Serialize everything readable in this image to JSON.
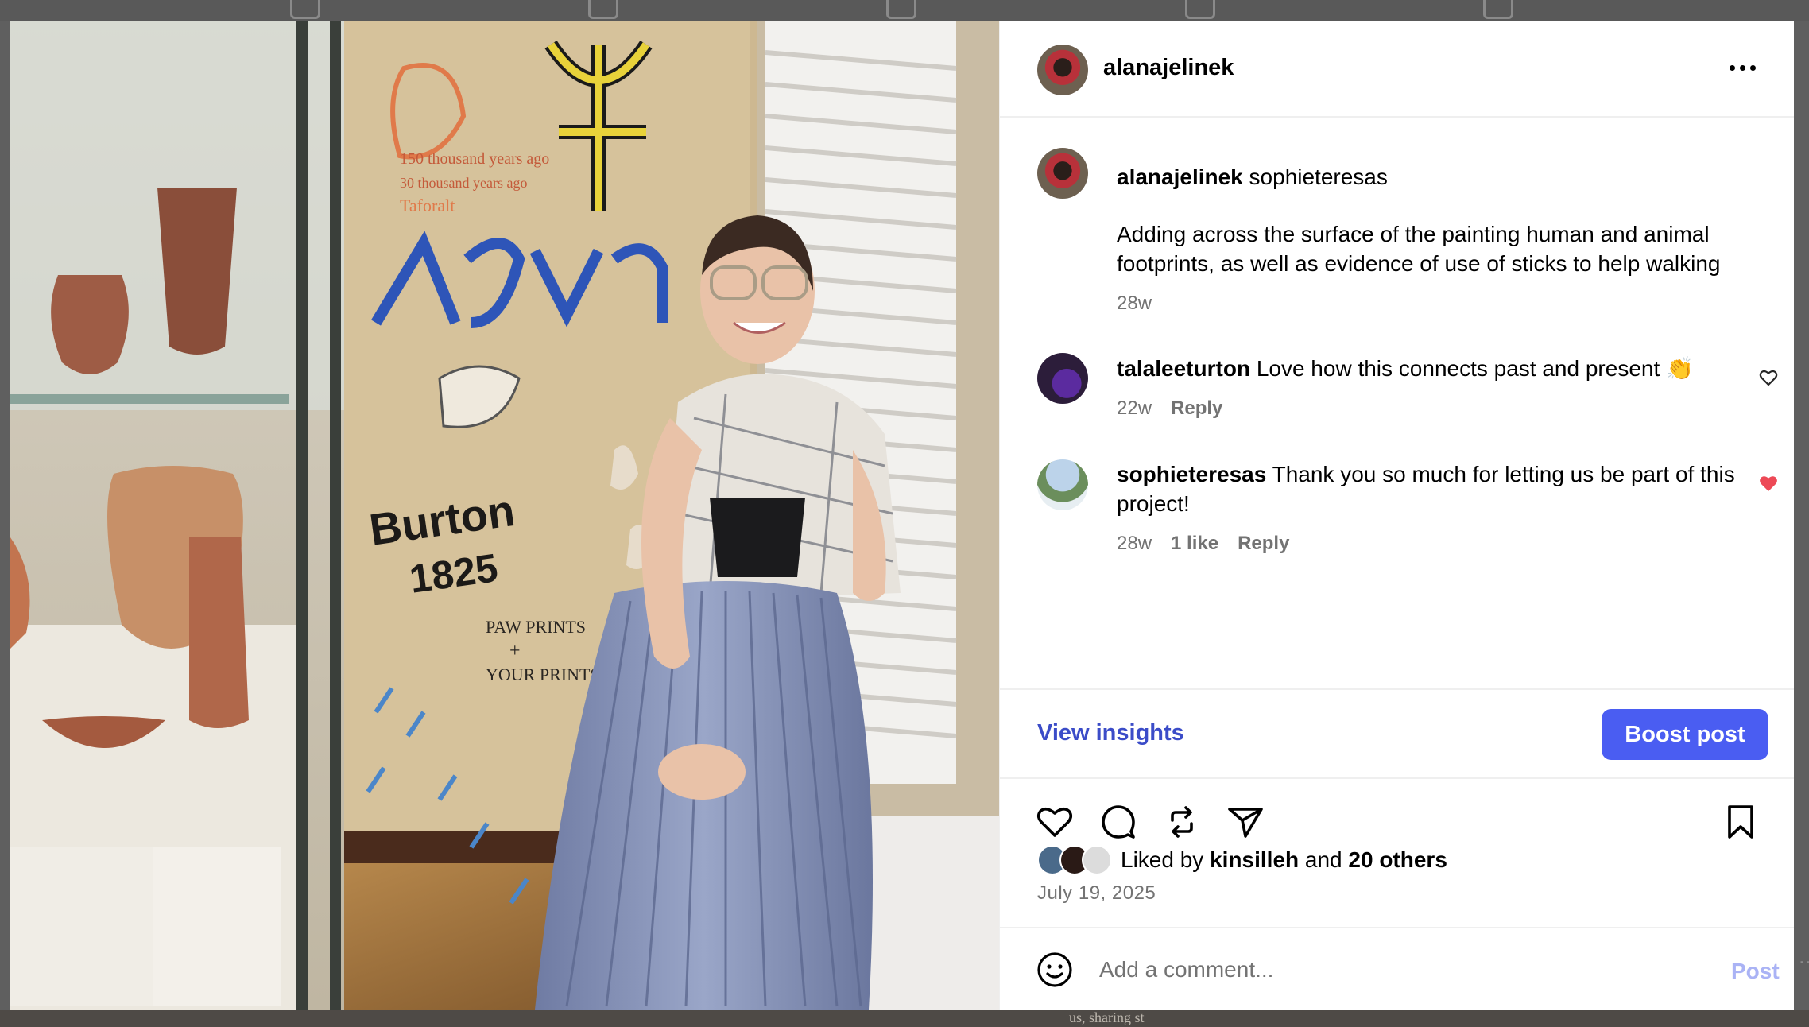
{
  "post": {
    "author": "alanajelinek",
    "more_icon": "more-horizontal-icon"
  },
  "caption": {
    "username": "alanajelinek",
    "tag": "sophieteresas",
    "text": "Adding across the surface of the painting human and animal footprints, as well as evidence of use of sticks to help walking",
    "time": "28w"
  },
  "comments": [
    {
      "username": "talaleeturton",
      "text": "Love how this connects past and present 👏",
      "time": "22w",
      "reply_label": "Reply",
      "liked": false
    },
    {
      "username": "sophieteresas",
      "text": "Thank you so much for letting us be part of this project!",
      "time": "28w",
      "likes_label": "1 like",
      "reply_label": "Reply",
      "liked": true
    }
  ],
  "insights": {
    "view_label": "View insights",
    "boost_label": "Boost post"
  },
  "actions": {
    "icons": [
      "heart-icon",
      "comment-icon",
      "repost-icon",
      "share-icon",
      "bookmark-icon"
    ]
  },
  "likes": {
    "prefix": "Liked by",
    "user": "kinsilleh",
    "middle": "and",
    "others": "20 others"
  },
  "date": "July 19, 2025",
  "comment_box": {
    "placeholder": "Add a comment...",
    "post_label": "Post"
  },
  "photo": {
    "mural_text_1": "Burton",
    "mural_text_2": "1825",
    "mural_text_3": "PAW PRINTS",
    "mural_text_4": "+",
    "mural_text_5": "YOUR PRINTS",
    "mural_text_6": "150 thousand years ago",
    "mural_text_7": "30 thousand years ago",
    "mural_text_8": "Taforalt"
  },
  "background": {
    "snippet": "us, sharing st"
  },
  "colors": {
    "accent_blue": "#4a5df2",
    "link_blue": "#3b4cc8",
    "like_red": "#ed4956",
    "muted_text": "#737373"
  }
}
